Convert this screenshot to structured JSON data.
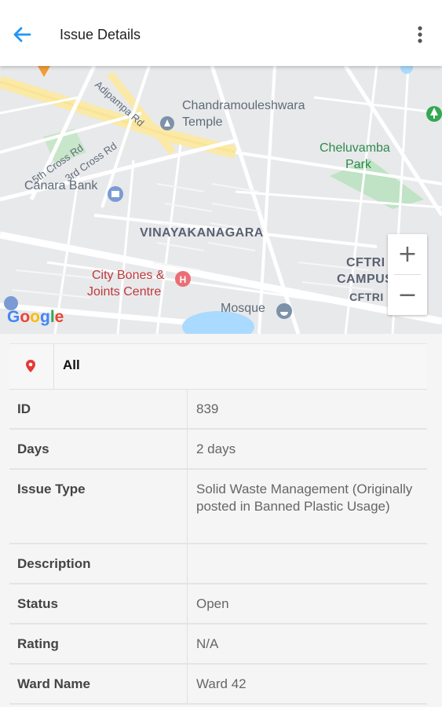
{
  "header": {
    "title": "Issue Details"
  },
  "map": {
    "labels": {
      "road_adipampa": "Adipampa Rd",
      "temple_line1": "Chandramouleshwara",
      "temple_line2": "Temple",
      "park_line1": "Cheluvamba",
      "park_line2": "Park",
      "road_5th": "5th Cross Rd",
      "road_3rd": "3rd Cross Rd",
      "canara_bank": "Canara Bank",
      "area": "VINAYAKANAGARA",
      "cftri_line1": "CFTRI",
      "cftri_line2": "CAMPUS",
      "cftri_line3": "CFTRI",
      "hospital_line1": "City Bones &",
      "hospital_line2": "Joints Centre",
      "mosque": "Mosque"
    },
    "zoom_in": "+",
    "zoom_out": "−",
    "google_letters": [
      "G",
      "o",
      "o",
      "g",
      "l",
      "e"
    ],
    "google_colors": [
      "#4285F4",
      "#EA4335",
      "#FBBC05",
      "#4285F4",
      "#34A853",
      "#EA4335"
    ]
  },
  "filter": {
    "value": "All"
  },
  "details": [
    {
      "key": "ID",
      "value": "839"
    },
    {
      "key": "Days",
      "value": "2 days"
    },
    {
      "key": "Issue Type",
      "value": "Solid Waste Management (Originally posted in Banned Plastic Usage)"
    },
    {
      "key": "Description",
      "value": ""
    },
    {
      "key": "Status",
      "value": "Open"
    },
    {
      "key": "Rating",
      "value": "N/A"
    },
    {
      "key": "Ward Name",
      "value": "Ward 42"
    }
  ],
  "colors": {
    "accent": "#2196F3",
    "pin": "#E53935"
  }
}
